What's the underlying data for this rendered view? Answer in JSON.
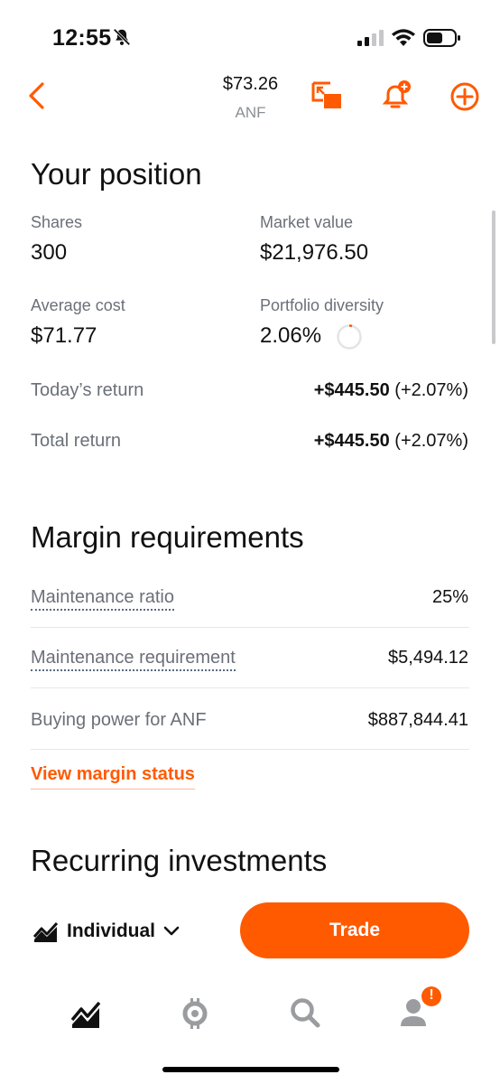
{
  "status_bar": {
    "time": "12:55"
  },
  "header": {
    "price": "$73.26",
    "symbol": "ANF"
  },
  "position": {
    "title": "Your position",
    "shares_label": "Shares",
    "shares_value": "300",
    "market_value_label": "Market value",
    "market_value": "$21,976.50",
    "avg_cost_label": "Average cost",
    "avg_cost_value": "$71.77",
    "diversity_label": "Portfolio diversity",
    "diversity_value": "2.06%",
    "diversity_fraction": 0.0206,
    "todays_return_label": "Today’s return",
    "todays_return_amount": "+$445.50",
    "todays_return_pct": "(+2.07%)",
    "total_return_label": "Total return",
    "total_return_amount": "+$445.50",
    "total_return_pct": "(+2.07%)"
  },
  "margin": {
    "title": "Margin requirements",
    "rows": [
      {
        "label": "Maintenance ratio",
        "value": "25%"
      },
      {
        "label": "Maintenance requirement",
        "value": "$5,494.12"
      },
      {
        "label": "Buying power for ANF",
        "value": "$887,844.41"
      }
    ],
    "link": "View margin status"
  },
  "recurring": {
    "title": "Recurring investments"
  },
  "action_bar": {
    "account": "Individual",
    "trade": "Trade"
  },
  "nav": {
    "badge": "!"
  },
  "colors": {
    "accent": "#ff5a00",
    "muted": "#6b7078",
    "nav_inactive": "#9a9ca0"
  }
}
